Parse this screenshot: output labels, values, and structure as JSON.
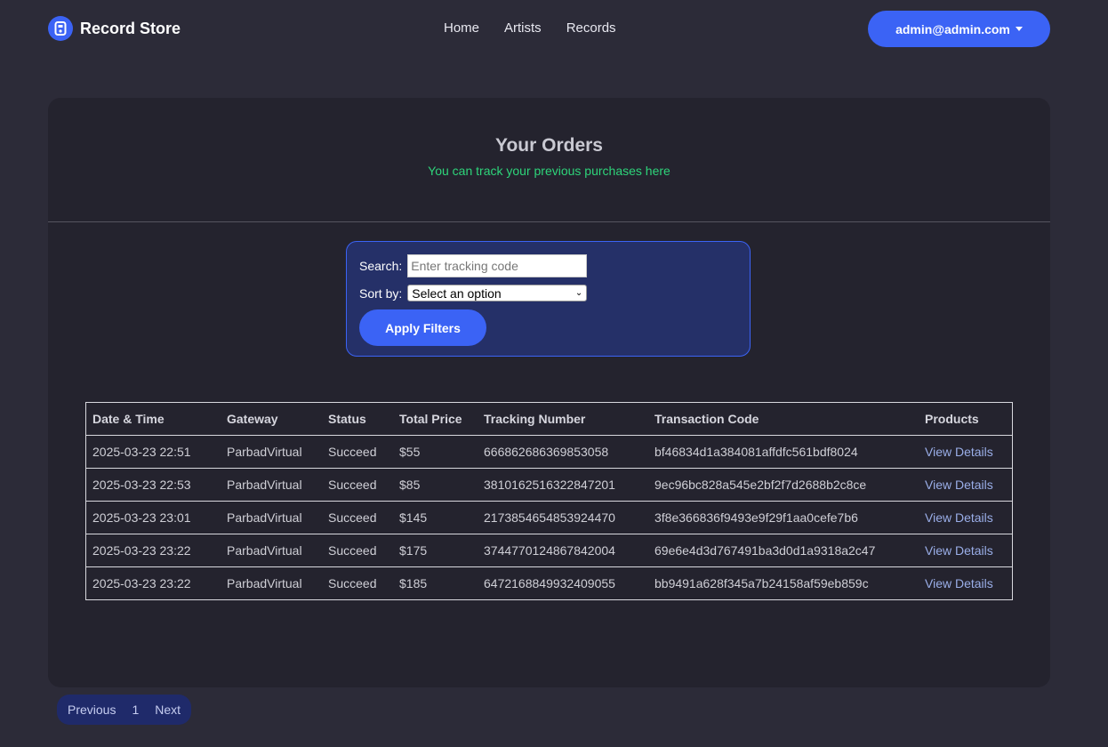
{
  "header": {
    "brand": "Record Store",
    "brand_icon": "record-store-icon",
    "nav": [
      "Home",
      "Artists",
      "Records"
    ],
    "user_email": "admin@admin.com"
  },
  "main": {
    "title": "Your Orders",
    "subtitle": "You can track your previous purchases here",
    "subtitle_color": "#2ed47a"
  },
  "filters": {
    "search_label": "Search:",
    "search_placeholder": "Enter tracking code",
    "search_value": "",
    "sort_label": "Sort by:",
    "sort_value": "Select an option",
    "apply_label": "Apply Filters"
  },
  "table": {
    "columns": [
      "Date & Time",
      "Gateway",
      "Status",
      "Total Price",
      "Tracking Number",
      "Transaction Code",
      "Products"
    ],
    "rows": [
      [
        "2025-03-23 22:51",
        "ParbadVirtual",
        "Succeed",
        "$55",
        "666862686369853058",
        "bf46834d1a384081affdfc561bdf8024",
        "View Details"
      ],
      [
        "2025-03-23 22:53",
        "ParbadVirtual",
        "Succeed",
        "$85",
        "3810162516322847201",
        "9ec96bc828a545e2bf2f7d2688b2c8ce",
        "View Details"
      ],
      [
        "2025-03-23 23:01",
        "ParbadVirtual",
        "Succeed",
        "$145",
        "2173854654853924470",
        "3f8e366836f9493e9f29f1aa0cefe7b6",
        "View Details"
      ],
      [
        "2025-03-23 23:22",
        "ParbadVirtual",
        "Succeed",
        "$175",
        "3744770124867842004",
        "69e6e4d3d767491ba3d0d1a9318a2c47",
        "View Details"
      ],
      [
        "2025-03-23 23:22",
        "ParbadVirtual",
        "Succeed",
        "$185",
        "6472168849932409055",
        "bb9491a628f345a7b24158af59eb859c",
        "View Details"
      ]
    ]
  },
  "pagination": {
    "prev": "Previous",
    "page": "1",
    "next": "Next"
  },
  "colors": {
    "accent": "#3b63f5",
    "background": "#2c2b38",
    "card": "#24232e"
  }
}
